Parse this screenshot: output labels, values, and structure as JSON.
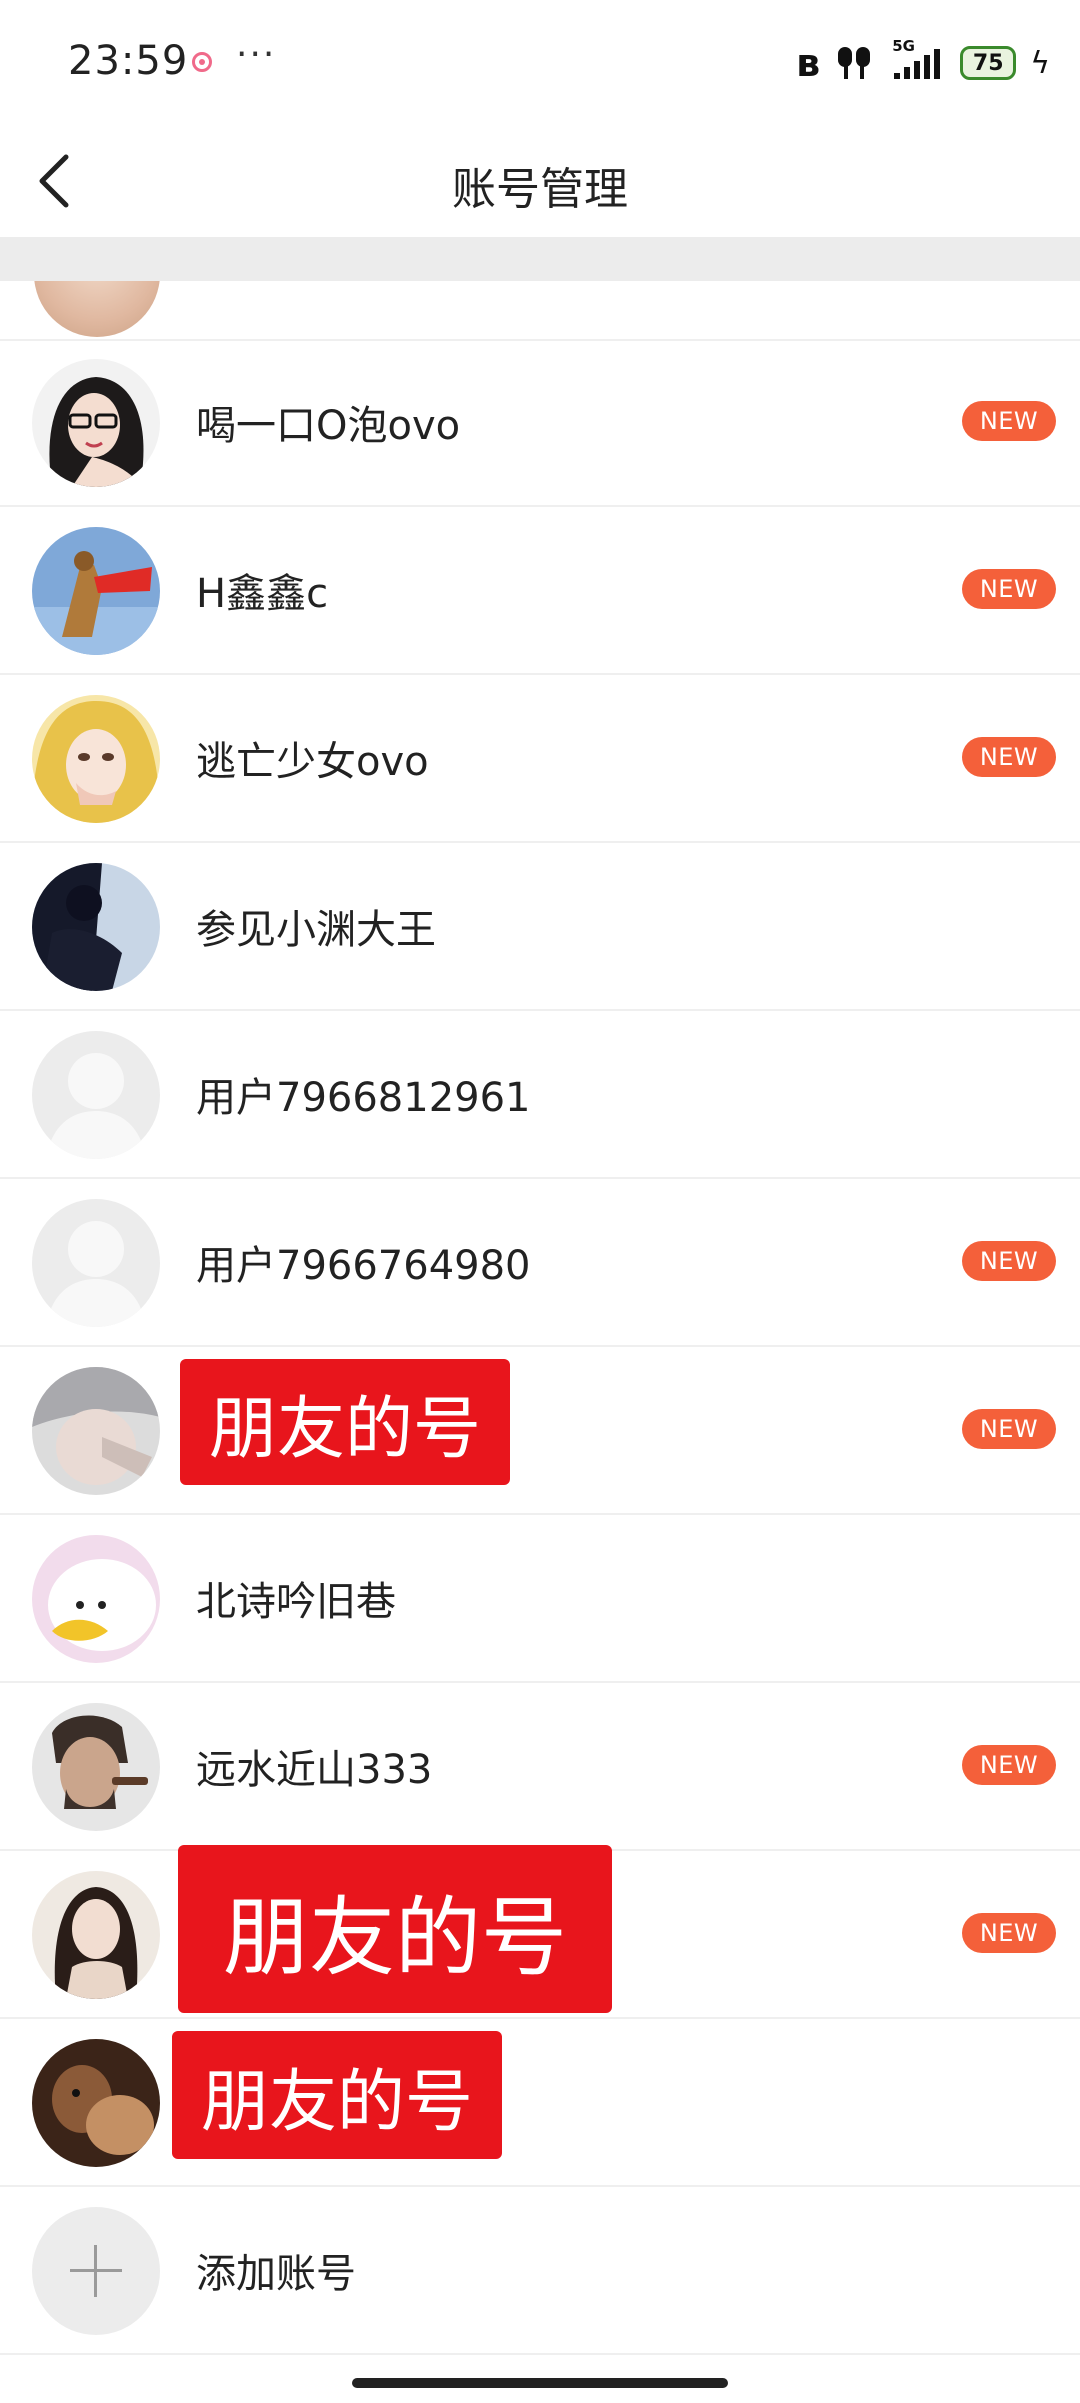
{
  "status_bar": {
    "time": "23:59",
    "more": "···",
    "battery": "75"
  },
  "nav": {
    "title": "账号管理"
  },
  "accounts": [
    {
      "name": "喝一口O泡ovo",
      "badge": "NEW",
      "avatar_icon": "girl-glasses-avatar"
    },
    {
      "name": "H鑫鑫c",
      "badge": "NEW",
      "avatar_icon": "dog-cape-avatar"
    },
    {
      "name": "逃亡少女ovo",
      "badge": "NEW",
      "avatar_icon": "blonde-girl-avatar"
    },
    {
      "name": "参见小渊大王",
      "badge": "",
      "avatar_icon": "dark-silhouette-avatar"
    },
    {
      "name": "用户7966812961",
      "badge": "",
      "avatar_icon": "default-avatar"
    },
    {
      "name": "用户7966764980",
      "badge": "NEW",
      "avatar_icon": "default-avatar"
    },
    {
      "name": "朋友的号",
      "badge": "NEW",
      "avatar_icon": "grey-boy-avatar"
    },
    {
      "name": "北诗吟旧巷",
      "badge": "",
      "avatar_icon": "duck-avatar"
    },
    {
      "name": "远水近山333",
      "badge": "NEW",
      "avatar_icon": "man-smoking-avatar"
    },
    {
      "name": "朋友的号",
      "badge": "NEW",
      "avatar_icon": "girl-portrait-avatar"
    },
    {
      "name": "朋友的号",
      "badge": "",
      "avatar_icon": "animal-avatar"
    }
  ],
  "add_account": {
    "label": "添加账号"
  },
  "colors": {
    "badge": "#f4603a",
    "red_label": "#e8151c",
    "divider": "#efefef"
  }
}
